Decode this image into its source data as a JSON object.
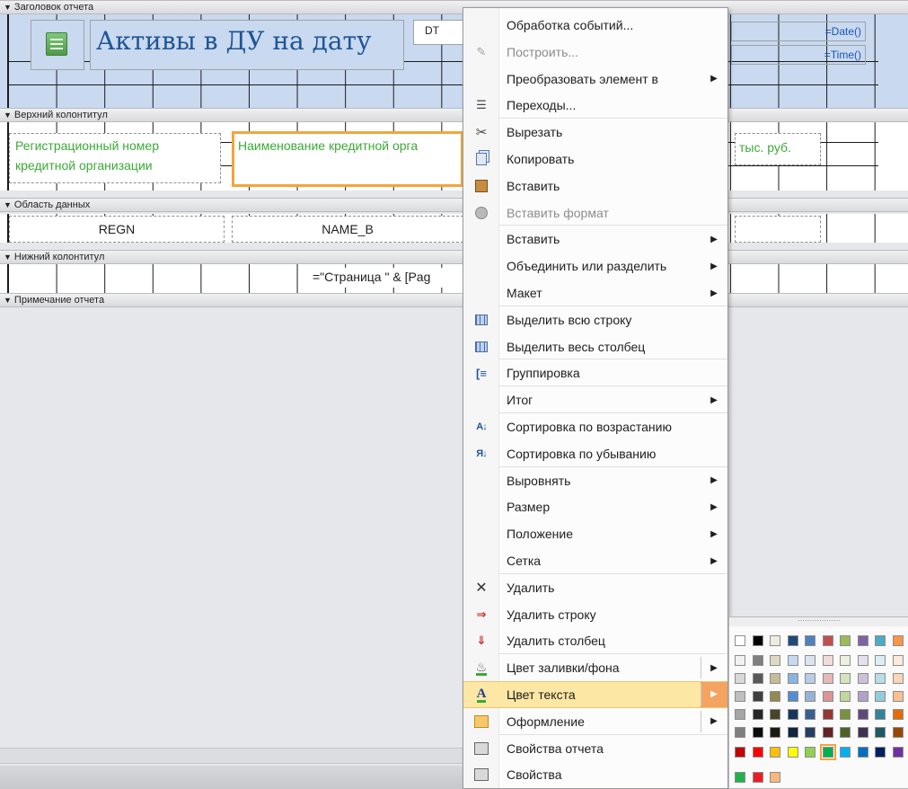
{
  "sections": {
    "report_header": "Заголовок отчета",
    "page_header": "Верхний колонтитул",
    "detail": "Область данных",
    "page_footer": "Нижний колонтитул",
    "report_footer": "Примечание отчета"
  },
  "report_header": {
    "title": "Активы в ДУ на дату",
    "dt_field": "DT",
    "date_expr": "=Date()",
    "time_expr": "=Time()"
  },
  "page_header": {
    "regnum_label": "Регистрационный номер кредитной организации",
    "name_label": "Наименование кредитной орга",
    "thousands_label": "тыс. руб."
  },
  "detail": {
    "regn_field": "REGN",
    "nameb_field": "NAME_B"
  },
  "page_footer": {
    "page_expr": "=\"Страница \" & [Pag"
  },
  "context_menu": {
    "items": [
      {
        "label": "Обработка событий...",
        "icon": "none",
        "submenu": false,
        "disabled": false
      },
      {
        "label": "Построить...",
        "icon": "build-icon",
        "submenu": false,
        "disabled": true
      },
      {
        "label": "Преобразовать элемент в",
        "icon": "none",
        "submenu": true,
        "disabled": false
      },
      {
        "label": "Переходы...",
        "icon": "transitions-icon",
        "submenu": false,
        "disabled": false
      },
      {
        "label": "Вырезать",
        "icon": "scissors-icon",
        "submenu": false,
        "disabled": false
      },
      {
        "label": "Копировать",
        "icon": "copy-icon",
        "submenu": false,
        "disabled": false
      },
      {
        "label": "Вставить",
        "icon": "paste-icon",
        "submenu": false,
        "disabled": false
      },
      {
        "label": "Вставить формат",
        "icon": "paste-format-icon",
        "submenu": false,
        "disabled": true
      },
      {
        "label": "Вставить",
        "icon": "none",
        "submenu": true,
        "disabled": false
      },
      {
        "label": "Объединить или разделить",
        "icon": "none",
        "submenu": true,
        "disabled": false
      },
      {
        "label": "Макет",
        "icon": "none",
        "submenu": true,
        "disabled": false
      },
      {
        "label": "Выделить всю строку",
        "icon": "select-row-icon",
        "submenu": false,
        "disabled": false
      },
      {
        "label": "Выделить весь столбец",
        "icon": "select-column-icon",
        "submenu": false,
        "disabled": false
      },
      {
        "label": "Группировка",
        "icon": "grouping-icon",
        "submenu": false,
        "disabled": false
      },
      {
        "label": "Итог",
        "icon": "none",
        "submenu": true,
        "disabled": false
      },
      {
        "label": "Сортировка по возрастанию",
        "icon": "sort-asc-icon",
        "submenu": false,
        "disabled": false
      },
      {
        "label": "Сортировка по убыванию",
        "icon": "sort-desc-icon",
        "submenu": false,
        "disabled": false
      },
      {
        "label": "Выровнять",
        "icon": "none",
        "submenu": true,
        "disabled": false
      },
      {
        "label": "Размер",
        "icon": "none",
        "submenu": true,
        "disabled": false
      },
      {
        "label": "Положение",
        "icon": "none",
        "submenu": true,
        "disabled": false
      },
      {
        "label": "Сетка",
        "icon": "none",
        "submenu": true,
        "disabled": false
      },
      {
        "label": "Удалить",
        "icon": "delete-icon",
        "submenu": false,
        "disabled": false
      },
      {
        "label": "Удалить строку",
        "icon": "delete-row-icon",
        "submenu": false,
        "disabled": false
      },
      {
        "label": "Удалить столбец",
        "icon": "delete-column-icon",
        "submenu": false,
        "disabled": false
      },
      {
        "label": "Цвет заливки/фона",
        "icon": "fill-color-icon",
        "submenu": true,
        "disabled": false
      },
      {
        "label": "Цвет текста",
        "icon": "text-color-icon",
        "submenu": true,
        "disabled": false,
        "highlighted": true
      },
      {
        "label": "Оформление",
        "icon": "shape-style-icon",
        "submenu": true,
        "disabled": false
      },
      {
        "label": "Свойства отчета",
        "icon": "report-properties-icon",
        "submenu": false,
        "disabled": false
      },
      {
        "label": "Свойства",
        "icon": "properties-icon",
        "submenu": false,
        "disabled": false
      }
    ]
  },
  "palette": {
    "rows": [
      [
        "#ffffff",
        "#000000",
        "#eeece1",
        "#1f497d",
        "#4f81bd",
        "#c0504d",
        "#9bbb59",
        "#8064a2",
        "#4bacc6",
        "#f79646"
      ],
      [
        "#f2f2f2",
        "#7f7f7f",
        "#ddd9c3",
        "#c6d9f0",
        "#dbe5f1",
        "#f2dcdb",
        "#ebf1dd",
        "#e5e0ec",
        "#dbeef3",
        "#fdeada"
      ],
      [
        "#d8d8d8",
        "#595959",
        "#c4bd97",
        "#8db3e2",
        "#b8cce4",
        "#e5b9b7",
        "#d7e3bc",
        "#ccc1d9",
        "#b7dde8",
        "#fbd5b5"
      ],
      [
        "#bfbfbf",
        "#3f3f3f",
        "#938953",
        "#548dd4",
        "#95b3d7",
        "#d99694",
        "#c3d69b",
        "#b2a2c7",
        "#92cddc",
        "#fac08f"
      ],
      [
        "#a5a5a5",
        "#262626",
        "#494429",
        "#17365d",
        "#366092",
        "#953734",
        "#76923c",
        "#5f497a",
        "#31859b",
        "#e36c09"
      ],
      [
        "#7f7f7f",
        "#0c0c0c",
        "#1d1b10",
        "#0f243e",
        "#244061",
        "#632423",
        "#4f6128",
        "#3f3151",
        "#205867",
        "#974806"
      ],
      [
        "#c00000",
        "#ff0000",
        "#ffc000",
        "#ffff00",
        "#92d050",
        "#00b050",
        "#00b0f0",
        "#0070c0",
        "#002060",
        "#7030a0"
      ],
      [
        "#22b14c",
        "#ed1c24",
        "#f7b87a"
      ]
    ],
    "selected": [
      6,
      5
    ]
  }
}
